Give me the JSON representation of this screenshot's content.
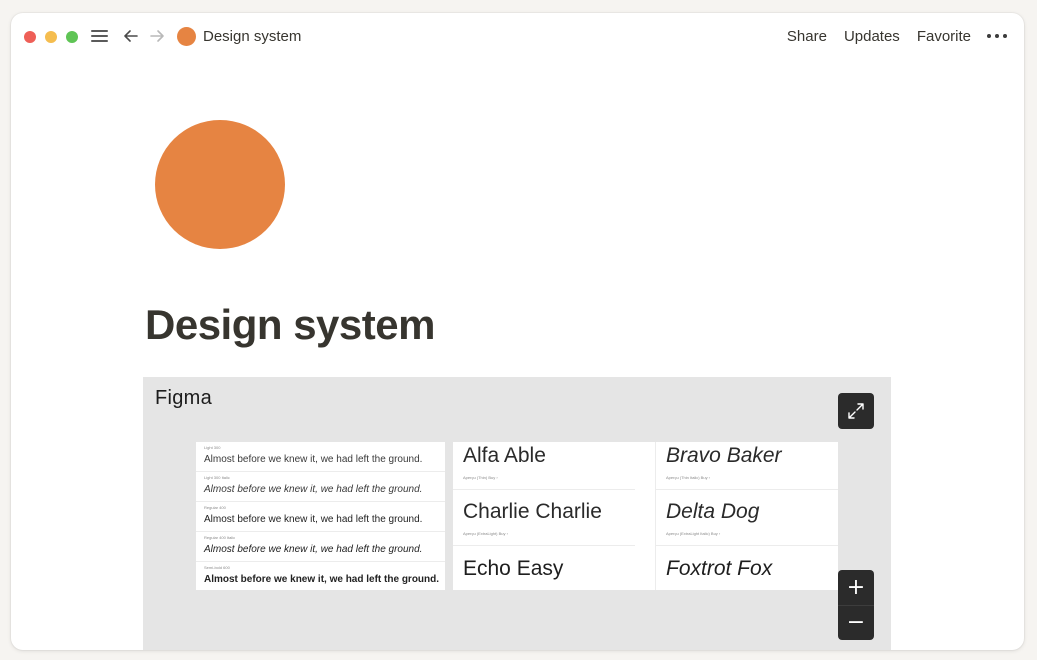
{
  "window": {
    "nav": {
      "menu_icon": "hamburger-icon",
      "back_icon": "arrow-left-icon",
      "forward_icon": "arrow-right-icon",
      "page_icon_color": "#e68442",
      "title": "Design system"
    },
    "actions": {
      "share": "Share",
      "updates": "Updates",
      "favorite": "Favorite",
      "more_icon": "more-horizontal-icon"
    }
  },
  "page": {
    "icon_color": "#e68442",
    "title": "Design system"
  },
  "embed": {
    "label": "Figma",
    "expand_icon": "expand-icon",
    "zoom_in": "+",
    "zoom_out": "−",
    "weights": [
      {
        "label": "Light 300",
        "sample": "Almost before we knew it, we had left the ground."
      },
      {
        "label": "Light 300 Italic",
        "sample": "Almost before we knew it, we had left the ground."
      },
      {
        "label": "Regular 400",
        "sample": "Almost before we knew it, we had left the ground."
      },
      {
        "label": "Regular 400 Italic",
        "sample": "Almost before we knew it, we had left the ground."
      },
      {
        "label": "Semi-bold 600",
        "sample": "Almost before we knew it, we had left the ground."
      }
    ],
    "samples": [
      {
        "name": "Alfa Able",
        "meta": "Aperçu (Thin)   Buy ›"
      },
      {
        "name": "Bravo Baker",
        "meta": "Aperçu (Thin Italic)   Buy ›"
      },
      {
        "name": "Charlie Charlie",
        "meta": "Aperçu (ExtraLight)   Buy ›"
      },
      {
        "name": "Delta Dog",
        "meta": "Aperçu (ExtraLight Italic)   Buy ›"
      },
      {
        "name": "Echo Easy",
        "meta": ""
      },
      {
        "name": "Foxtrot Fox",
        "meta": ""
      }
    ]
  }
}
